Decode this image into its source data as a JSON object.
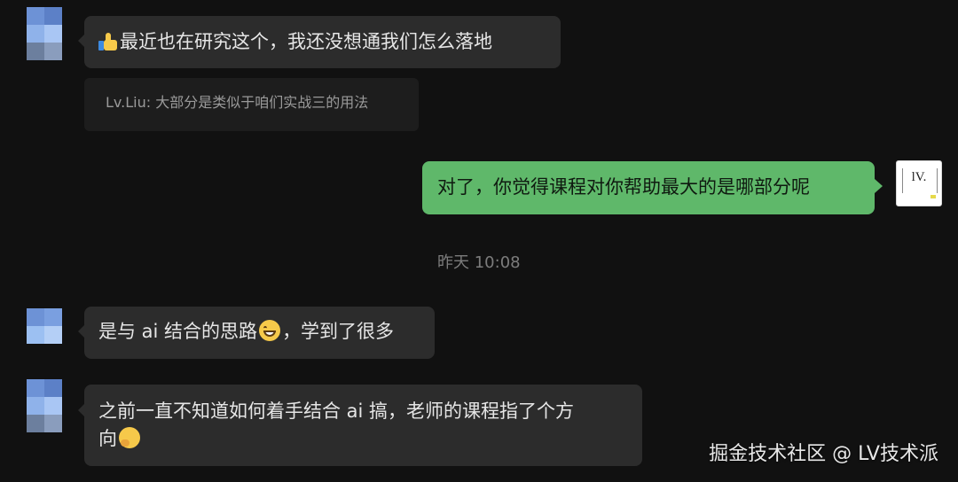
{
  "messages": [
    {
      "side": "left",
      "emoji": "thumbs-up",
      "text": "最近也在研究这个，我还没想通我们怎么落地",
      "quote": "Lv.Liu: 大部分是类似于咱们实战三的用法"
    },
    {
      "side": "right",
      "text": "对了，你觉得课程对你帮助最大的是哪部分呢"
    },
    {
      "side": "left",
      "text_before": "是与 ai 结合的思路",
      "emoji": "grinning-face",
      "text_after": "，学到了很多"
    },
    {
      "side": "left",
      "line1": "之前一直不知道如何着手结合 ai 搞，老师的课程指了个方",
      "line2": "向",
      "emoji": "thinking-face"
    }
  ],
  "timestamp": "昨天 10:08",
  "self_avatar_text": "lV.",
  "watermark": "掘金技术社区 @ LV技术派",
  "colors": {
    "background": "#111111",
    "incoming_bubble": "#2c2c2c",
    "outgoing_bubble": "#5fb86a",
    "quote_bg": "#1d1d1d",
    "avatar_blue_light": "#9cc0f2",
    "avatar_blue_dark": "#5f86d0"
  }
}
